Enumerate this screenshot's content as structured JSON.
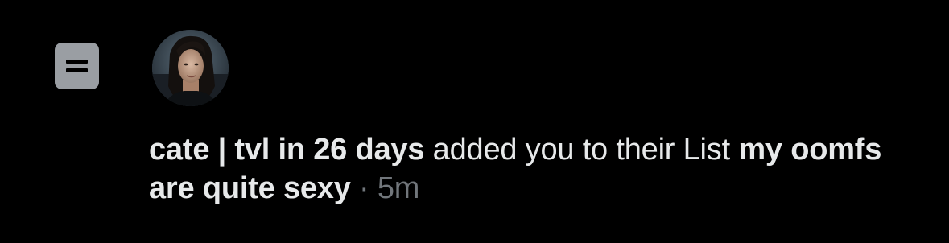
{
  "notification": {
    "icon": "list-icon",
    "avatar": {
      "alt": "profile photo"
    },
    "actor_name": "cate | tvl in 26 days",
    "action_text": " added you to their List ",
    "list_name": "my oomfs are quite sexy",
    "separator": " · ",
    "timestamp": "5m"
  },
  "colors": {
    "background": "#000000",
    "text_primary": "#e7e9ea",
    "text_secondary": "#71767b",
    "icon_tile": "#9a9ea3"
  }
}
